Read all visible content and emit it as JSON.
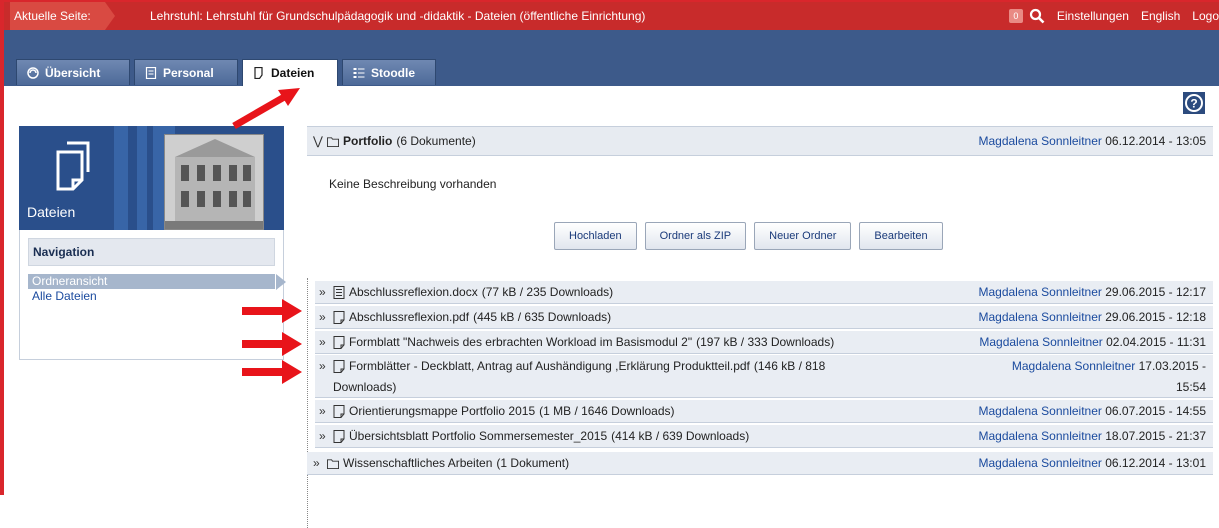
{
  "topbar": {
    "current_label": "Aktuelle Seite:",
    "breadcrumb": "Lehrstuhl: Lehrstuhl für Grundschulpädagogik und -didaktik - Dateien (öffentliche Einrichtung)",
    "badge": "0",
    "settings": "Einstellungen",
    "language": "English",
    "logout": "Logo"
  },
  "tabs": [
    {
      "label": "Übersicht",
      "icon": "overview-icon"
    },
    {
      "label": "Personal",
      "icon": "personal-icon"
    },
    {
      "label": "Dateien",
      "icon": "files-icon",
      "active": true
    },
    {
      "label": "Stoodle",
      "icon": "stoodle-icon"
    }
  ],
  "sidebar": {
    "title": "Dateien",
    "nav_heading": "Navigation",
    "items": [
      {
        "label": "Ordneransicht",
        "selected": true
      },
      {
        "label": "Alle Dateien",
        "selected": false
      }
    ]
  },
  "folder": {
    "name": "Portfolio",
    "count": "(6 Dokumente)",
    "author": "Magdalena Sonnleitner",
    "date": "06.12.2014 - 13:05",
    "description": "Keine Beschreibung vorhanden",
    "buttons": [
      "Hochladen",
      "Ordner als ZIP",
      "Neuer Ordner",
      "Bearbeiten"
    ]
  },
  "files": [
    {
      "name": "Abschlussreflexion.docx",
      "meta": "(77 kB / 235 Downloads)",
      "author": "Magdalena Sonnleitner",
      "date": "29.06.2015 - 12:17"
    },
    {
      "name": "Abschlussreflexion.pdf",
      "meta": "(445 kB / 635 Downloads)",
      "author": "Magdalena Sonnleitner",
      "date": "29.06.2015 - 12:18"
    },
    {
      "name": "Formblatt \"Nachweis des erbrachten Workload im Basismodul 2\"",
      "meta": "(197 kB / 333 Downloads)",
      "author": "Magdalena Sonnleitner",
      "date": "02.04.2015 - 11:31"
    },
    {
      "name": "Formblätter - Deckblatt, Antrag auf Aushändigung ,Erklärung Produktteil.pdf",
      "meta": "(146 kB / 818",
      "meta2": "Downloads)",
      "author": "Magdalena Sonnleitner",
      "date": "17.03.2015 -",
      "date2": "15:54"
    },
    {
      "name": "Orientierungsmappe Portfolio 2015",
      "meta": "(1 MB / 1646 Downloads)",
      "author": "Magdalena Sonnleitner",
      "date": "06.07.2015 - 14:55"
    },
    {
      "name": "Übersichtsblatt Portfolio Sommersemester_2015",
      "meta": "(414 kB / 639 Downloads)",
      "author": "Magdalena Sonnleitner",
      "date": "18.07.2015 - 21:37"
    }
  ],
  "subfolder": {
    "name": "Wissenschaftliches Arbeiten",
    "count": "(1 Dokument)",
    "author": "Magdalena Sonnleitner",
    "date": "06.12.2014 - 13:01"
  },
  "colors": {
    "topbar": "#c82b2b",
    "tabbar": "#3d5a8a",
    "link": "#1a4a9e",
    "annotation_arrow": "#e8141a"
  }
}
